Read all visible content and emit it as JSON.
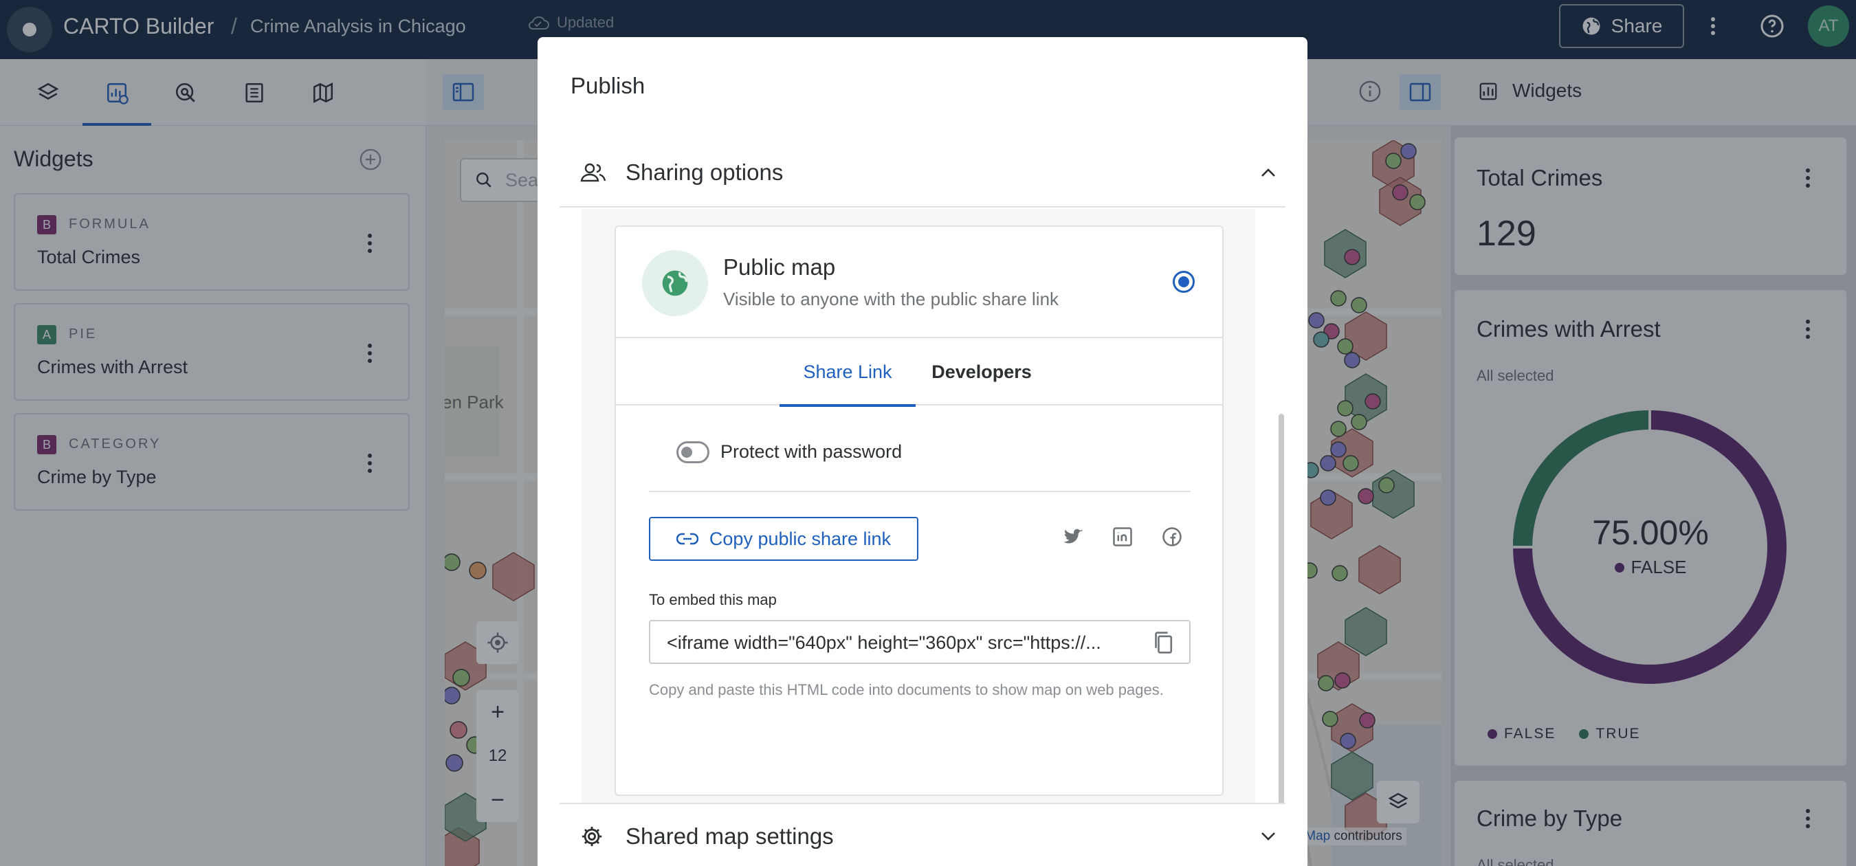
{
  "topbar": {
    "app_name": "CARTO Builder",
    "separator": "/",
    "map_name": "Crime Analysis in Chicago",
    "status": "Updated",
    "share_label": "Share",
    "avatar_initials": "AT"
  },
  "left_panel": {
    "tabs": [
      "layers-icon",
      "widgets-icon",
      "interactions-icon",
      "data-table-icon",
      "basemap-icon"
    ],
    "active_tab": "widgets-icon",
    "title": "Widgets",
    "widgets": [
      {
        "badge": "B",
        "type": "FORMULA",
        "name": "Total Crimes",
        "badge_color": "#7b2d6f"
      },
      {
        "badge": "A",
        "type": "PIE",
        "name": "Crimes with Arrest",
        "badge_color": "#3d8a6a"
      },
      {
        "badge": "B",
        "type": "CATEGORY",
        "name": "Crime by Type",
        "badge_color": "#7b2d6f"
      }
    ]
  },
  "map": {
    "search_placeholder": "Sea",
    "park_label": "en Park",
    "zoom_level": "12",
    "zoom_in": "+",
    "zoom_out": "−",
    "attribution_link": "tMap",
    "attribution_text": "contributors"
  },
  "right_panel": {
    "title": "Widgets",
    "total_crimes": {
      "title": "Total Crimes",
      "value": "129"
    },
    "crimes_with_arrest": {
      "title": "Crimes with Arrest",
      "subtitle": "All selected",
      "center_value": "75.00%",
      "center_label": "FALSE",
      "legend": [
        {
          "label": "FALSE",
          "color": "#5a2a6e"
        },
        {
          "label": "TRUE",
          "color": "#2f7a5c"
        }
      ]
    },
    "crime_by_type": {
      "title": "Crime by Type",
      "subtitle": "All selected"
    }
  },
  "dialog": {
    "title": "Publish",
    "sharing_section": "Sharing options",
    "option": {
      "title": "Public map",
      "subtitle": "Visible to anyone with the public share link",
      "selected": true
    },
    "tabs": [
      {
        "label": "Share Link",
        "active": true
      },
      {
        "label": "Developers",
        "active": false
      }
    ],
    "password_label": "Protect with password",
    "password_enabled": false,
    "copy_link_label": "Copy public share link",
    "social": [
      "twitter-icon",
      "linkedin-icon",
      "facebook-icon"
    ],
    "embed_label": "To embed this map",
    "embed_code": "<iframe width=\"640px\" height=\"360px\" src=\"https://...",
    "embed_help": "Copy and paste this HTML code into documents to show map on web pages.",
    "settings_section": "Shared map settings"
  },
  "colors": {
    "accent": "#1f5fbd",
    "topbar": "#162945",
    "pie_false": "#5a2a6e",
    "pie_true": "#2f7a5c"
  }
}
